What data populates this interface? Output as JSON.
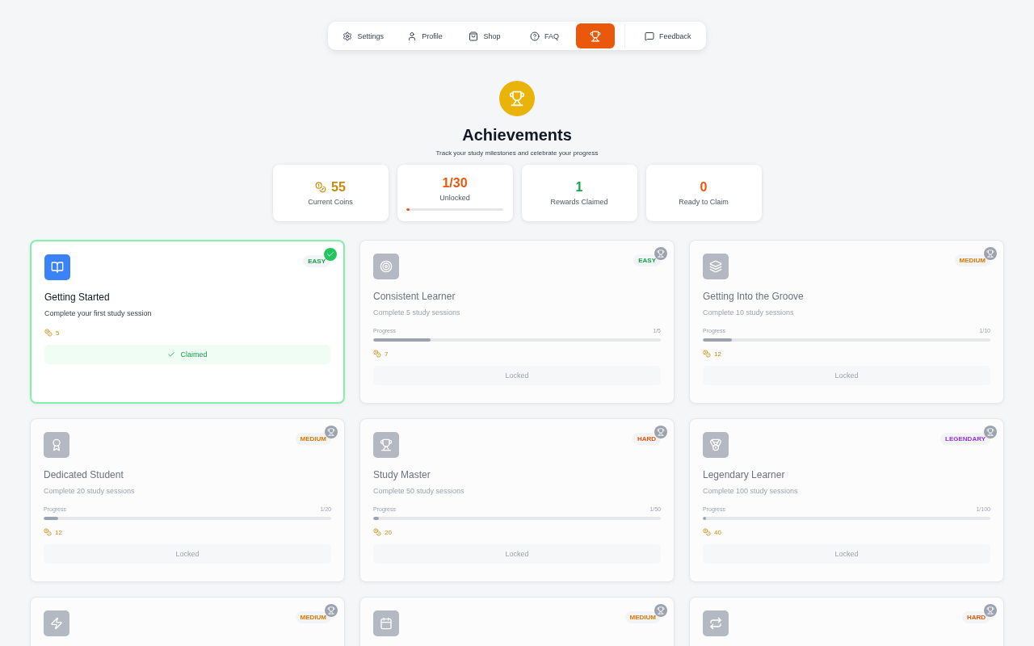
{
  "nav": [
    {
      "label": "Settings",
      "selected": false
    },
    {
      "label": "Profile",
      "selected": false
    },
    {
      "label": "Shop",
      "selected": false
    },
    {
      "label": "FAQ",
      "selected": false
    },
    {
      "selected": true
    },
    {
      "label": "Feedback",
      "selected": false
    }
  ],
  "header": {
    "title": "Achievements",
    "subtitle": "Track your study milestones and celebrate your progress"
  },
  "stats": [
    {
      "value": "55",
      "label": "Current Coins",
      "kind": "coins"
    },
    {
      "value": "1/30",
      "label": "Unlocked",
      "kind": "progress",
      "level": 0.033
    },
    {
      "value": "1",
      "label": "Rewards Claimed",
      "kind": "success"
    },
    {
      "value": "0",
      "label": "Ready to Claim",
      "kind": "pending"
    }
  ],
  "achievements": [
    {
      "title": "Getting Started",
      "description": "Complete your first study session",
      "badge": "EASY",
      "color": "#16a34a",
      "claimed": true,
      "reward": "5",
      "action": "Claimed"
    },
    {
      "title": "Consistent Learner",
      "description": "Complete 5 study sessions",
      "badge": "EASY",
      "color": "#16a34a",
      "claimed": false,
      "progress_label": "Progress",
      "progress": "1/5",
      "level": 0.2,
      "reward": "7",
      "action": "Locked"
    },
    {
      "title": "Getting Into the Groove",
      "description": "Complete 10 study sessions",
      "badge": "MEDIUM",
      "color": "#d97706",
      "claimed": false,
      "progress_label": "Progress",
      "progress": "1/10",
      "level": 0.1,
      "reward": "12",
      "action": "Locked"
    },
    {
      "title": "Dedicated Student",
      "description": "Complete 20 study sessions",
      "badge": "MEDIUM",
      "color": "#d97706",
      "claimed": false,
      "progress_label": "Progress",
      "progress": "1/20",
      "level": 0.05,
      "reward": "12",
      "action": "Locked"
    },
    {
      "title": "Study Master",
      "description": "Complete 50 study sessions",
      "badge": "HARD",
      "color": "#ea580c",
      "claimed": false,
      "progress_label": "Progress",
      "progress": "1/50",
      "level": 0.02,
      "reward": "20",
      "action": "Locked"
    },
    {
      "title": "Legendary Learner",
      "description": "Complete 100 study sessions",
      "badge": "LEGENDARY",
      "color": "#9333ea",
      "claimed": false,
      "progress_label": "Progress",
      "progress": "1/100",
      "level": 0.01,
      "reward": "40",
      "action": "Locked"
    },
    {
      "badge": "MEDIUM",
      "color": "#d97706",
      "claimed": false
    },
    {
      "badge": "MEDIUM",
      "color": "#d97706",
      "claimed": false
    },
    {
      "badge": "HARD",
      "color": "#ea580c",
      "claimed": false
    }
  ]
}
